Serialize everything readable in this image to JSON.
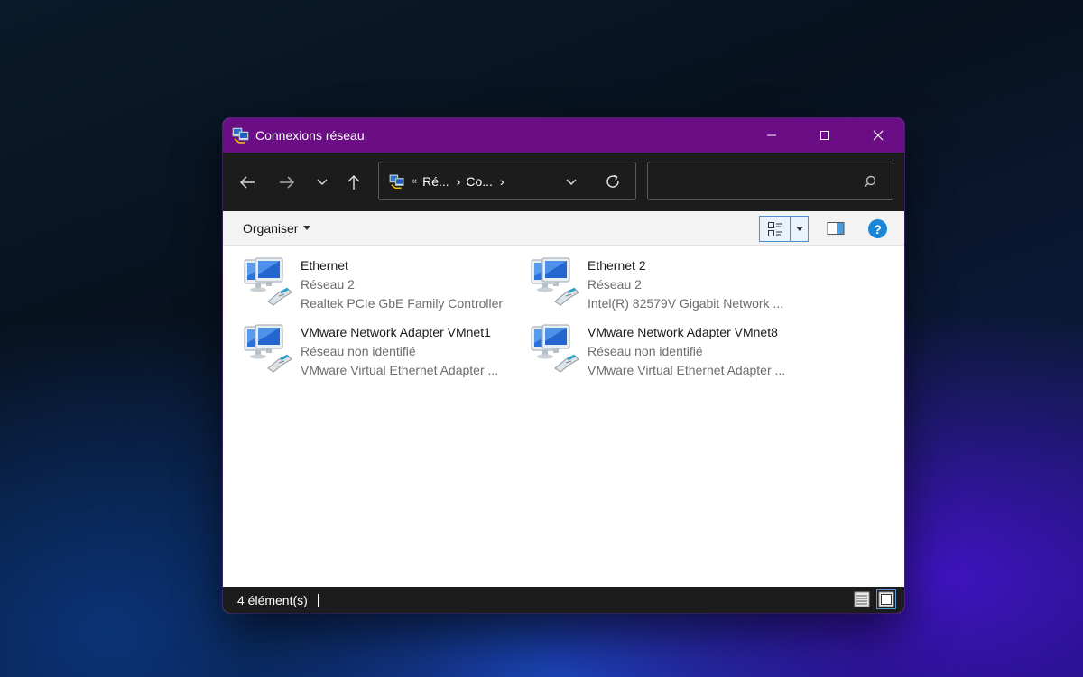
{
  "window": {
    "title": "Connexions réseau"
  },
  "address": {
    "overflow": "«",
    "segments": [
      "Ré...",
      "Co..."
    ],
    "separator": "›"
  },
  "search": {
    "placeholder": ""
  },
  "toolbar": {
    "organiser_label": "Organiser",
    "help_label": "?"
  },
  "items": [
    {
      "name": "Ethernet",
      "network": "Réseau 2",
      "device": "Realtek PCIe GbE Family Controller"
    },
    {
      "name": "Ethernet 2",
      "network": "Réseau 2",
      "device": "Intel(R) 82579V Gigabit Network ..."
    },
    {
      "name": "VMware Network Adapter VMnet1",
      "network": "Réseau non identifié",
      "device": "VMware Virtual Ethernet Adapter ..."
    },
    {
      "name": "VMware Network Adapter VMnet8",
      "network": "Réseau non identifié",
      "device": "VMware Virtual Ethernet Adapter ..."
    }
  ],
  "status": {
    "count": "4 élément(s)"
  },
  "colors": {
    "titlebar": "#6b0e86",
    "dark_bar": "#1c1c1c",
    "accent": "#1a86d8"
  },
  "icons": {
    "title": "network-connections-icon",
    "item": "network-adapter-icon"
  }
}
